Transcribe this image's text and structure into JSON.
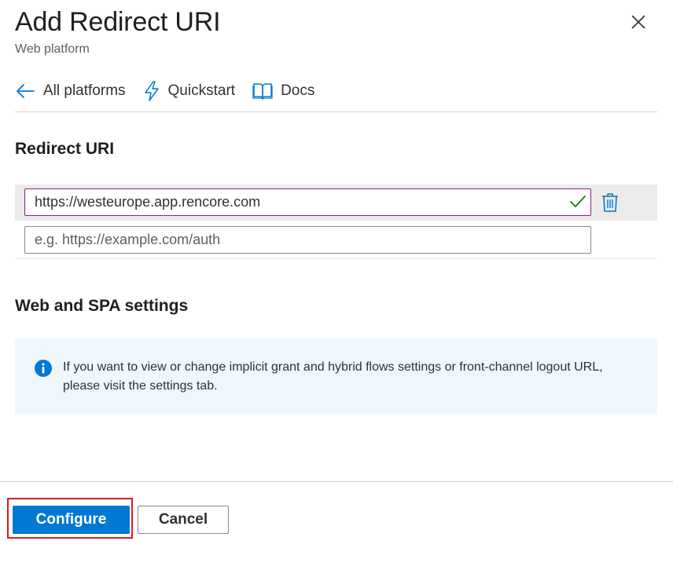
{
  "panel": {
    "title": "Add Redirect URI",
    "subtitle": "Web platform"
  },
  "toolbar": {
    "items": [
      {
        "label": "All platforms",
        "icon": "arrow-left-icon"
      },
      {
        "label": "Quickstart",
        "icon": "lightning-icon"
      },
      {
        "label": "Docs",
        "icon": "book-icon"
      }
    ]
  },
  "redirect": {
    "heading": "Redirect URI",
    "uris": [
      {
        "value": "https://westeurope.app.rencore.com",
        "valid": true
      }
    ],
    "placeholder": "e.g. https://example.com/auth"
  },
  "settings": {
    "heading": "Web and SPA settings",
    "info_text": "If you want to view or change implicit grant and hybrid flows settings or front-channel logout URL, please visit the settings tab."
  },
  "footer": {
    "configure_label": "Configure",
    "cancel_label": "Cancel"
  },
  "colors": {
    "accent": "#0078d4",
    "valid": "#107c10",
    "highlight": "#e3191f",
    "focus_border": "#8e1e8f"
  }
}
